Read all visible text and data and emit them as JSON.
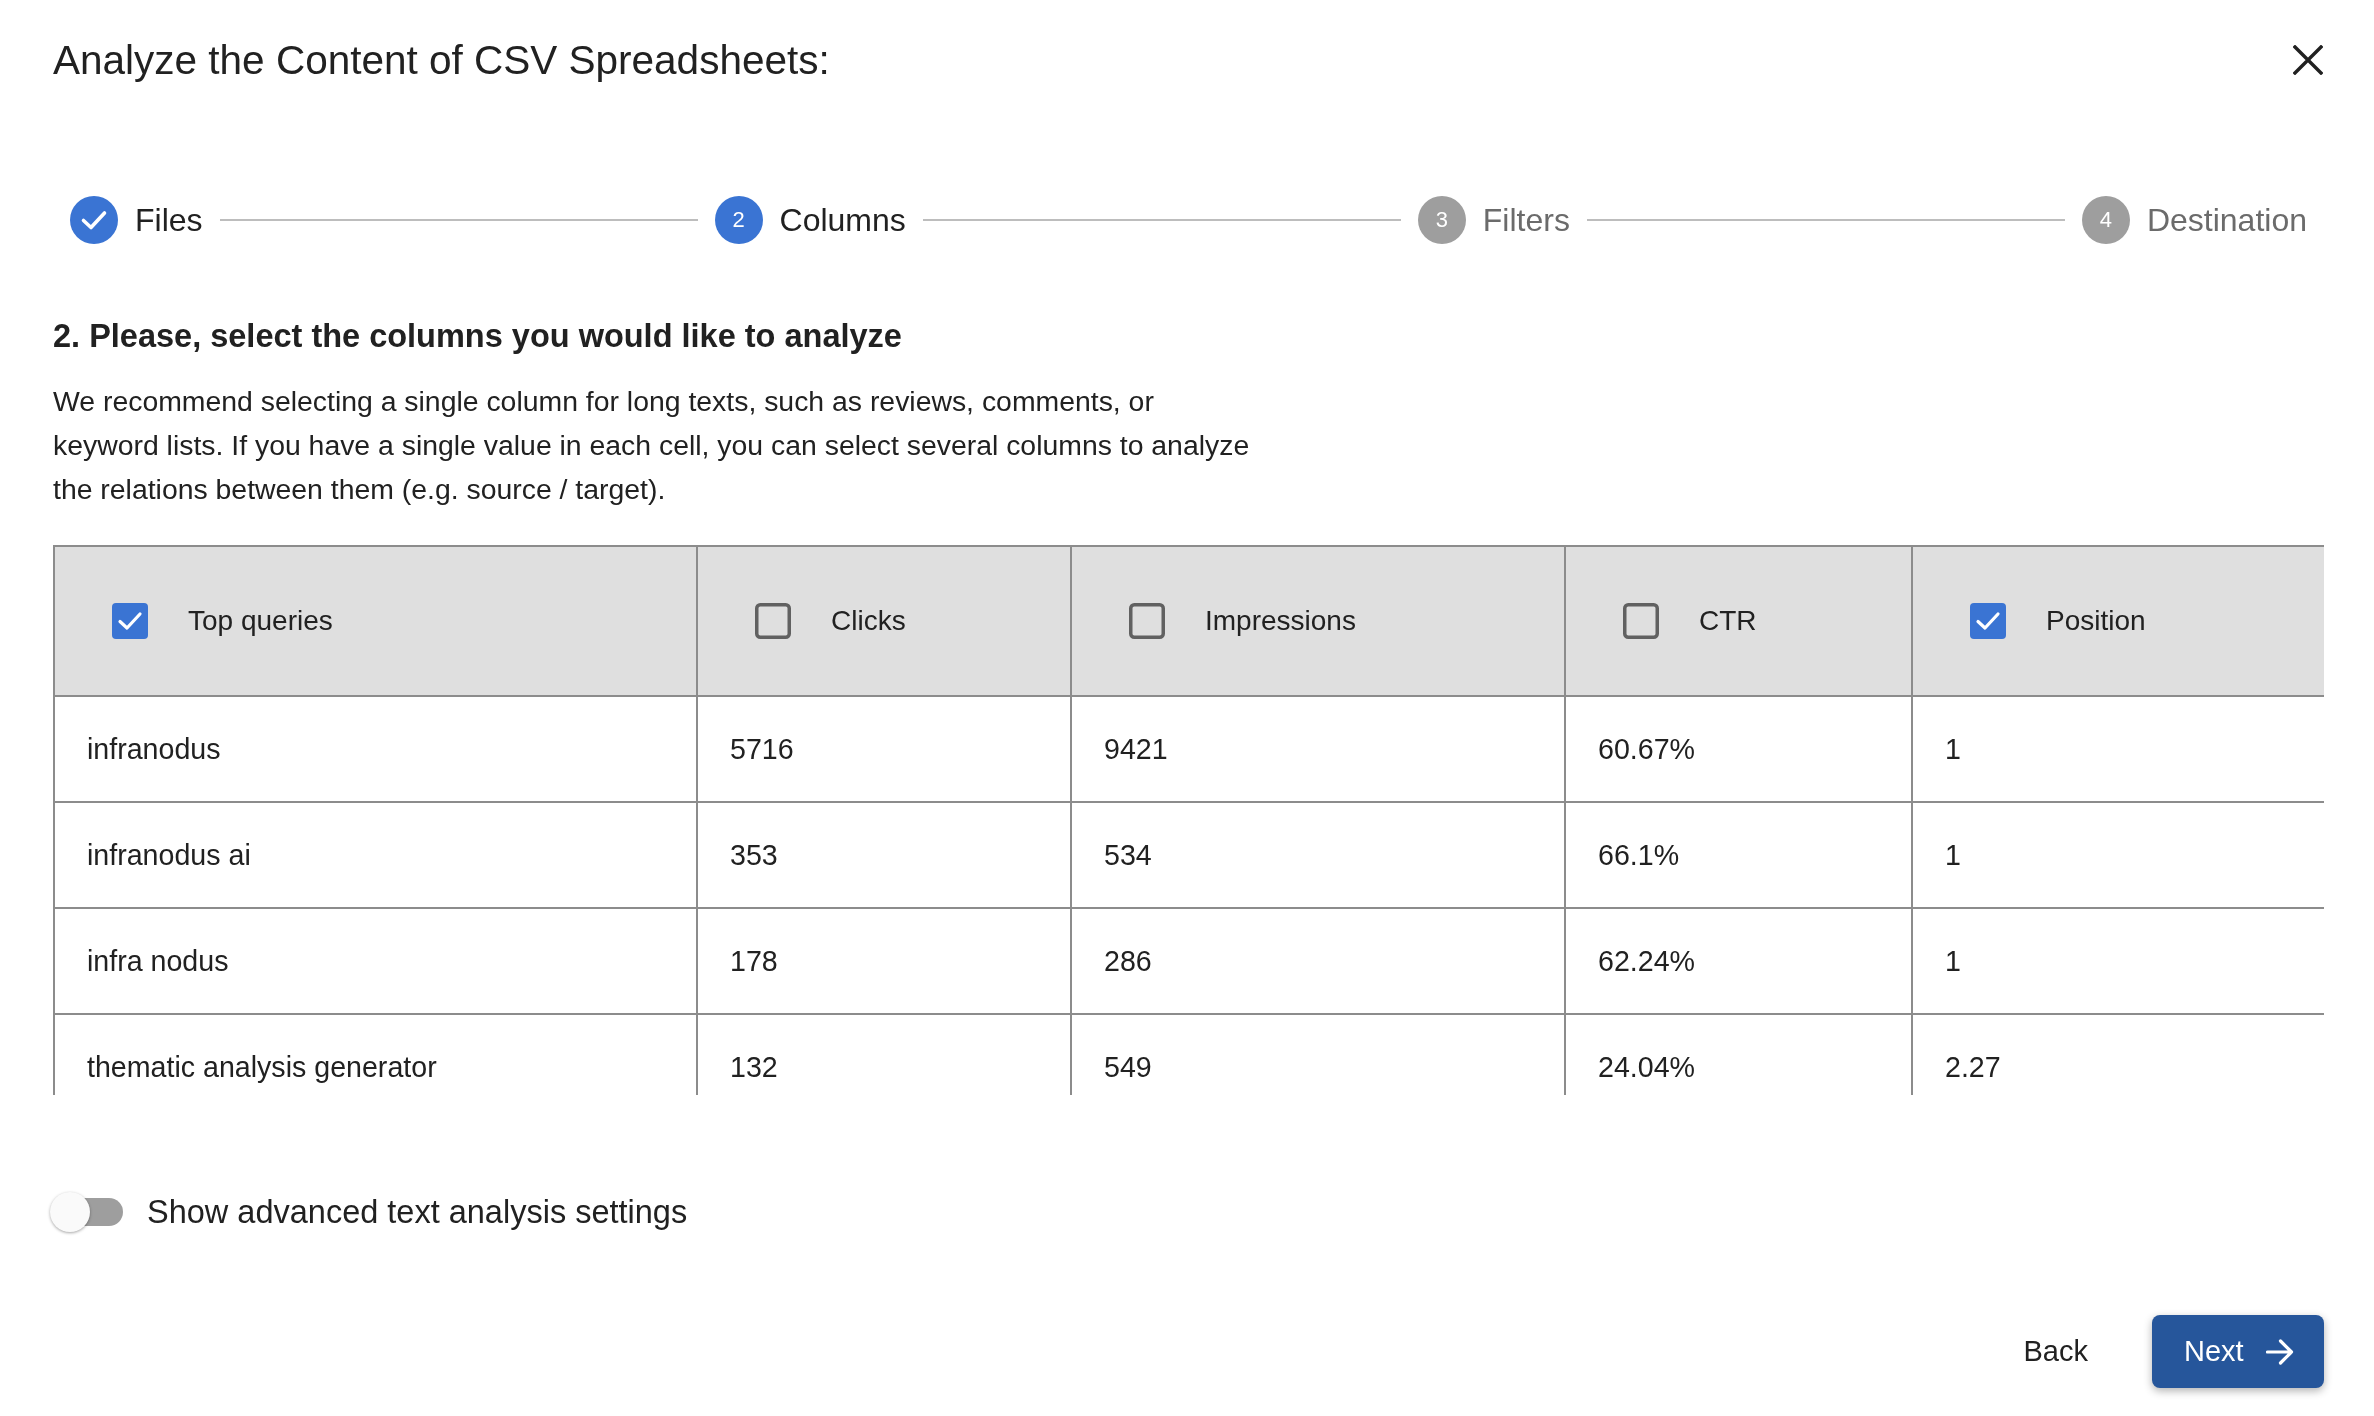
{
  "dialog": {
    "title": "Analyze the Content of CSV Spreadsheets:"
  },
  "steps": [
    {
      "label": "Files",
      "completed": true,
      "selected": false
    },
    {
      "number": "2",
      "label": "Columns",
      "completed": false,
      "selected": true
    },
    {
      "number": "3",
      "label": "Filters",
      "completed": false,
      "selected": false
    },
    {
      "number": "4",
      "label": "Destination",
      "completed": false,
      "selected": false
    }
  ],
  "section": {
    "heading": "2. Please, select the columns you would like to analyze",
    "description": "We recommend selecting a single column for long texts, such as reviews, comments, or keyword lists. If you have a single value in each cell, you can select several columns to analyze the relations between them (e.g. source / target)."
  },
  "table": {
    "columns": [
      {
        "label": "Top queries",
        "checked": true
      },
      {
        "label": "Clicks",
        "checked": false
      },
      {
        "label": "Impressions",
        "checked": false
      },
      {
        "label": "CTR",
        "checked": false
      },
      {
        "label": "Position",
        "checked": true
      }
    ],
    "rows": [
      [
        "infranodus",
        "5716",
        "9421",
        "60.67%",
        "1"
      ],
      [
        "infranodus ai",
        "353",
        "534",
        "66.1%",
        "1"
      ],
      [
        "infra nodus",
        "178",
        "286",
        "62.24%",
        "1"
      ],
      [
        "thematic analysis generator",
        "132",
        "549",
        "24.04%",
        "2.27"
      ]
    ]
  },
  "toggle": {
    "label": "Show advanced text analysis settings",
    "on": false
  },
  "buttons": [
    {
      "label": "Back",
      "kind": "text"
    },
    {
      "label": "Next",
      "kind": "primary"
    }
  ]
}
